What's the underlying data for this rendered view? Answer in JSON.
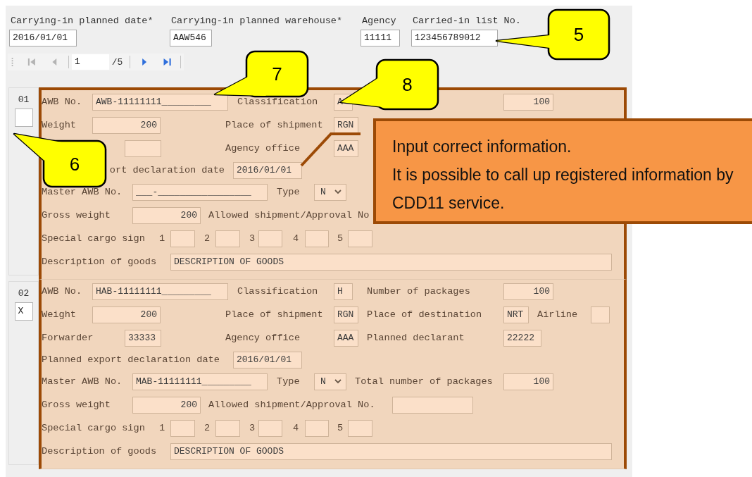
{
  "header": {
    "fields": [
      {
        "label": "Carrying-in planned date*",
        "value": "2016/01/01"
      },
      {
        "label": "Carrying-in planned warehouse*",
        "value": "AAW546"
      },
      {
        "label": "Agency",
        "value": "11111"
      },
      {
        "label": "Carried-in list No.",
        "value": "123456789012"
      }
    ]
  },
  "pager": {
    "buttons": [
      {
        "kind": "first",
        "disabled": true
      },
      {
        "kind": "previous",
        "disabled": true
      },
      {
        "kind": "next",
        "disabled": false
      },
      {
        "kind": "last",
        "disabled": false
      }
    ],
    "page": "1",
    "total": "/5"
  },
  "records": [
    {
      "number": "01",
      "lines": [
        {
          "items": [
            {
              "kind": "label",
              "text": "AWB No."
            },
            {
              "kind": "field",
              "value": "AWB-11111111_________"
            },
            {
              "kind": "label",
              "text": "Classification"
            },
            {
              "kind": "field",
              "value": "A"
            },
            {
              "kind": "covered"
            },
            {
              "kind": "numeric",
              "value": "100"
            }
          ]
        },
        {
          "items": [
            {
              "kind": "label",
              "text": "Weight"
            },
            {
              "kind": "numeric",
              "value": "200"
            },
            {
              "kind": "label",
              "text": "Place of shipment"
            },
            {
              "kind": "field",
              "value": "RGN"
            }
          ]
        },
        {
          "items": [
            {
              "kind": "covered"
            },
            {
              "kind": "field"
            },
            {
              "kind": "label",
              "text": "Agency office"
            },
            {
              "kind": "field",
              "value": "AAA"
            }
          ]
        },
        {
          "items": [
            {
              "kind": "label-tail",
              "text": "ort declaration date"
            },
            {
              "kind": "field",
              "value": "2016/01/01"
            }
          ]
        },
        {
          "items": [
            {
              "kind": "label",
              "text": "Master AWB No."
            },
            {
              "kind": "field",
              "value": "___-_________________"
            },
            {
              "kind": "label",
              "text": "Type"
            },
            {
              "kind": "select",
              "value": "N"
            }
          ]
        },
        {
          "items": [
            {
              "kind": "label",
              "text": "Gross weight"
            },
            {
              "kind": "numeric",
              "value": "200"
            },
            {
              "kind": "label",
              "text": "Allowed shipment/Approval No"
            }
          ]
        },
        {
          "items": [
            {
              "kind": "label",
              "text": "Special cargo sign"
            },
            {
              "kind": "label",
              "text": "1"
            },
            {
              "kind": "field"
            },
            {
              "kind": "label",
              "text": "2"
            },
            {
              "kind": "field"
            },
            {
              "kind": "label",
              "text": "3"
            },
            {
              "kind": "field"
            },
            {
              "kind": "label",
              "text": "4"
            },
            {
              "kind": "field"
            },
            {
              "kind": "label",
              "text": "5"
            },
            {
              "kind": "field"
            }
          ]
        },
        {
          "items": [
            {
              "kind": "label",
              "text": "Description of goods"
            },
            {
              "kind": "field",
              "value": "DESCRIPTION OF GOODS"
            }
          ]
        }
      ]
    },
    {
      "number": "02",
      "mark": "X",
      "lines": [
        {
          "items": [
            {
              "kind": "label",
              "text": "AWB No."
            },
            {
              "kind": "field",
              "value": "HAB-11111111_________"
            },
            {
              "kind": "label",
              "text": "Classification"
            },
            {
              "kind": "field",
              "value": "H"
            },
            {
              "kind": "label",
              "text": "Number of packages"
            },
            {
              "kind": "numeric",
              "value": "100"
            }
          ]
        },
        {
          "items": [
            {
              "kind": "label",
              "text": "Weight"
            },
            {
              "kind": "numeric",
              "value": "200"
            },
            {
              "kind": "label",
              "text": "Place of shipment"
            },
            {
              "kind": "field",
              "value": "RGN"
            },
            {
              "kind": "label",
              "text": "Place of destination"
            },
            {
              "kind": "field",
              "value": "NRT"
            },
            {
              "kind": "label",
              "text": "Airline"
            },
            {
              "kind": "field"
            }
          ]
        },
        {
          "items": [
            {
              "kind": "label",
              "text": "Forwarder"
            },
            {
              "kind": "field",
              "value": "33333"
            },
            {
              "kind": "label",
              "text": "Agency office"
            },
            {
              "kind": "field",
              "value": "AAA"
            },
            {
              "kind": "label",
              "text": "Planned declarant"
            },
            {
              "kind": "field",
              "value": "22222"
            }
          ]
        },
        {
          "items": [
            {
              "kind": "label",
              "text": "Planned export declaration date"
            },
            {
              "kind": "field",
              "value": "2016/01/01"
            }
          ]
        },
        {
          "items": [
            {
              "kind": "label",
              "text": "Master AWB No."
            },
            {
              "kind": "field",
              "value": "MAB-11111111_________"
            },
            {
              "kind": "label",
              "text": "Type"
            },
            {
              "kind": "select",
              "value": "N"
            },
            {
              "kind": "label",
              "text": "Total number of packages"
            },
            {
              "kind": "numeric",
              "value": "100"
            }
          ]
        },
        {
          "items": [
            {
              "kind": "label",
              "text": "Gross weight"
            },
            {
              "kind": "numeric",
              "value": "200"
            },
            {
              "kind": "label",
              "text": "Allowed shipment/Approval No."
            },
            {
              "kind": "field"
            }
          ]
        },
        {
          "items": [
            {
              "kind": "label",
              "text": "Special cargo sign"
            },
            {
              "kind": "label",
              "text": "1"
            },
            {
              "kind": "field"
            },
            {
              "kind": "label",
              "text": "2"
            },
            {
              "kind": "field"
            },
            {
              "kind": "label",
              "text": "3"
            },
            {
              "kind": "field"
            },
            {
              "kind": "label",
              "text": "4"
            },
            {
              "kind": "field"
            },
            {
              "kind": "label",
              "text": "5"
            },
            {
              "kind": "field"
            }
          ]
        },
        {
          "items": [
            {
              "kind": "label",
              "text": "Description of goods"
            },
            {
              "kind": "field",
              "value": "DESCRIPTION OF GOODS"
            }
          ]
        }
      ]
    }
  ],
  "callouts": [
    {
      "text": "5"
    },
    {
      "text": "7"
    },
    {
      "text": "8"
    },
    {
      "text": "6"
    }
  ],
  "note": {
    "lines": [
      "Input correct information.",
      "It is possible to call up registered information by CDD11 service."
    ]
  }
}
